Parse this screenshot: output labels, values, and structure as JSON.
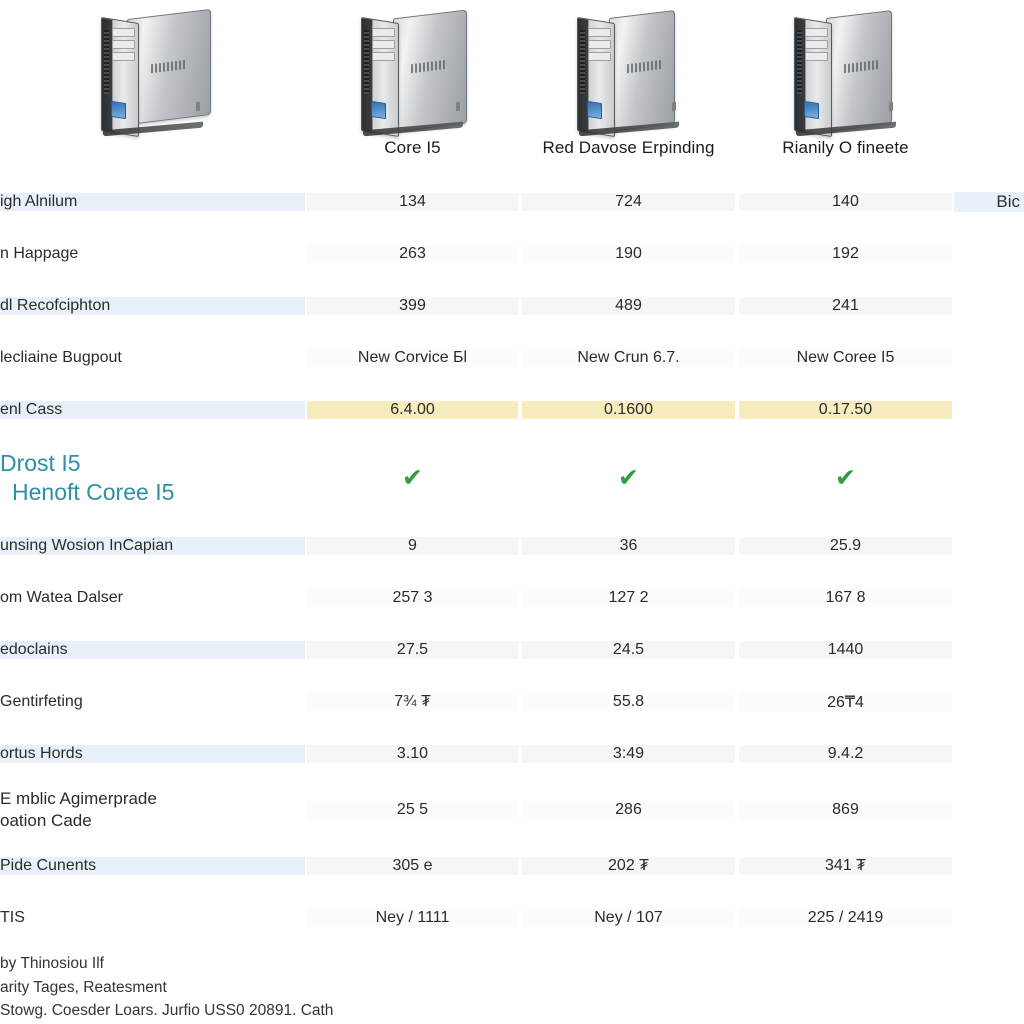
{
  "products": [
    {
      "name": "",
      "image": "desktop-tower-icon"
    },
    {
      "name": "Core I5",
      "image": "desktop-tower-icon"
    },
    {
      "name": "Red Davose Erpinding",
      "image": "desktop-tower-icon"
    },
    {
      "name": "Rianily O fineete",
      "image": "desktop-tower-icon"
    }
  ],
  "colors": {
    "stripe": "#e8f1f9",
    "highlight": "#f7ecbe",
    "link": "#2e8fa6",
    "check": "#2f9e3f"
  },
  "rows": [
    {
      "label": "igh Alnilum",
      "values": [
        "134",
        "724",
        "140"
      ],
      "edge": "Bic",
      "band": "a"
    },
    {
      "label": "n Happage",
      "values": [
        "263",
        "190",
        "192"
      ],
      "edge": "",
      "band": "b"
    },
    {
      "label": "dl Recofciphton",
      "values": [
        "399",
        "489",
        "241"
      ],
      "edge": "",
      "band": "a"
    },
    {
      "label": "lecliaine Bugpout",
      "values": [
        "New Corvice Бl",
        "New Crun 6.7.",
        "New Coree I5"
      ],
      "edge": "",
      "band": "b"
    },
    {
      "label": "enl Cass",
      "values": [
        "6.4.00",
        "0.1600",
        "0.17.50"
      ],
      "edge": "",
      "band": "hl"
    },
    {
      "label_lines": [
        "Drost I5",
        "Henoft Coree I5"
      ],
      "values": [
        "check",
        "check",
        "check"
      ],
      "edge": "",
      "band": "link"
    },
    {
      "label": "unsing Wosion InCapian",
      "values": [
        "9",
        "36",
        "25.9"
      ],
      "edge": "",
      "band": "a"
    },
    {
      "label": "om Watea Dalser",
      "values": [
        "257 3",
        "127 2",
        "167 8"
      ],
      "edge": "",
      "band": "b"
    },
    {
      "label": "edoclains",
      "values": [
        "27.5",
        "24.5",
        "1440"
      ],
      "edge": "",
      "band": "a"
    },
    {
      "label": "Gentirfeting",
      "values": [
        "7¾ ₮",
        "55.8",
        "26₸4"
      ],
      "edge": "",
      "band": "b"
    },
    {
      "label": "ortus Hords",
      "values": [
        "3.10",
        "3:49",
        "9.4.2"
      ],
      "edge": "",
      "band": "a"
    },
    {
      "label_lines": [
        "E mblic Agimerprade",
        "oation Cade"
      ],
      "values": [
        "25 5",
        "286",
        "869"
      ],
      "edge": "",
      "band": "b"
    },
    {
      "label": "Pide Cunents",
      "values": [
        "305 e",
        "202 ₮",
        "341 ₮"
      ],
      "edge": "",
      "band": "a"
    },
    {
      "label": "TIS",
      "values": [
        "Ney / 1111",
        "Ney / 107",
        "225 / 2419"
      ],
      "edge": "",
      "band": "b"
    }
  ],
  "footer": {
    "line1": "by Thinosiou Ilf",
    "line2": "arity Tages, Reatesment",
    "line3": "Stowg. Coesder Loars. Jurfio USS0 20891. Cath"
  }
}
